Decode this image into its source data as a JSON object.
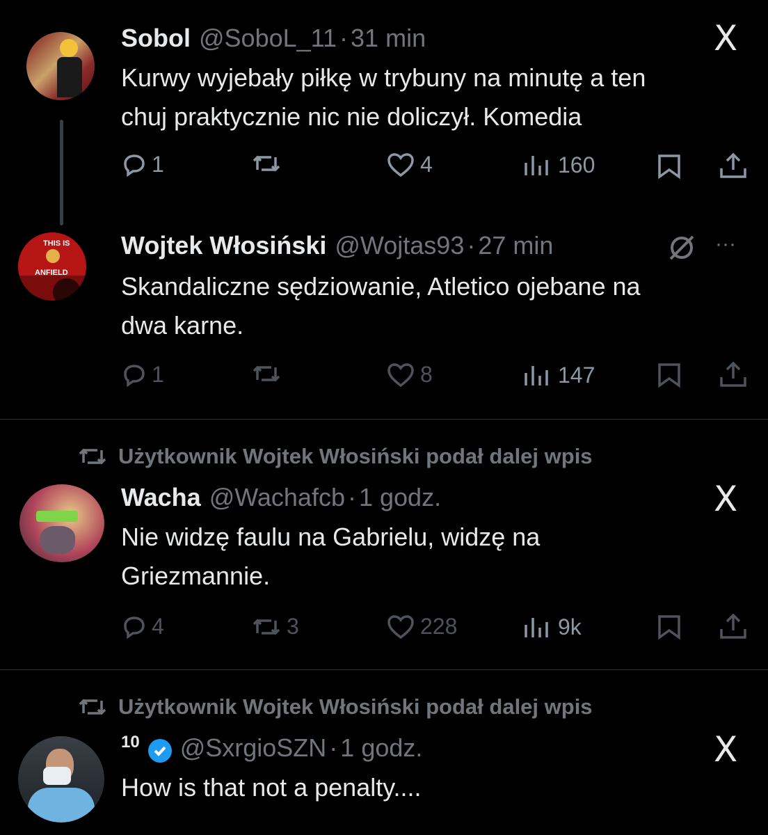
{
  "tweets": [
    {
      "name": "Sobol",
      "handle": "@SoboL_11",
      "time": "31 min",
      "text_lines": [
        "Kurwy wyjebały piłkę w trybuny na minutę a ten",
        "chuj praktycznie nic nie doliczył. Komedia"
      ],
      "replies": "1",
      "reposts": "",
      "likes": "4",
      "views": "160"
    },
    {
      "name": "Wojtek Włosiński",
      "handle": "@Wojtas93",
      "time": "27 min",
      "text_lines": [
        "Skandaliczne sędziowanie, Atletico ojebane na",
        "dwa karne."
      ],
      "replies": "1",
      "reposts": "",
      "likes": "8",
      "views": "147",
      "avatar_text_top": "THIS IS",
      "avatar_text_bottom": "ANFIELD"
    },
    {
      "repost_label": "Użytkownik Wojtek Włosiński podał dalej wpis",
      "name": "Wacha",
      "handle": "@Wachafcb",
      "time": "1 godz.",
      "text_lines": [
        "Nie widzę faulu na Gabrielu, widzę na",
        "Griezmannie."
      ],
      "replies": "4",
      "reposts": "3",
      "likes": "228",
      "views": "9k"
    },
    {
      "repost_label": "Użytkownik Wojtek Włosiński podał dalej wpis",
      "name": "10",
      "handle": "@SxrgioSZN",
      "time": "1 godz.",
      "text_lines": [
        "How is that not a penalty...."
      ]
    }
  ],
  "separator": "·",
  "x_logo": "X",
  "more": "···",
  "icons": {
    "reply": "speech-bubble-icon",
    "repost": "repost-arrows-icon",
    "like": "heart-icon",
    "views": "bar-chart-icon",
    "bookmark": "bookmark-icon",
    "share": "share-upload-icon",
    "grok": "slashed-circle-icon",
    "verified": "verified-badge-icon"
  },
  "colors": {
    "background": "#000000",
    "text": "#e7e9ea",
    "muted": "#71767b",
    "verified": "#1d9bf0"
  }
}
